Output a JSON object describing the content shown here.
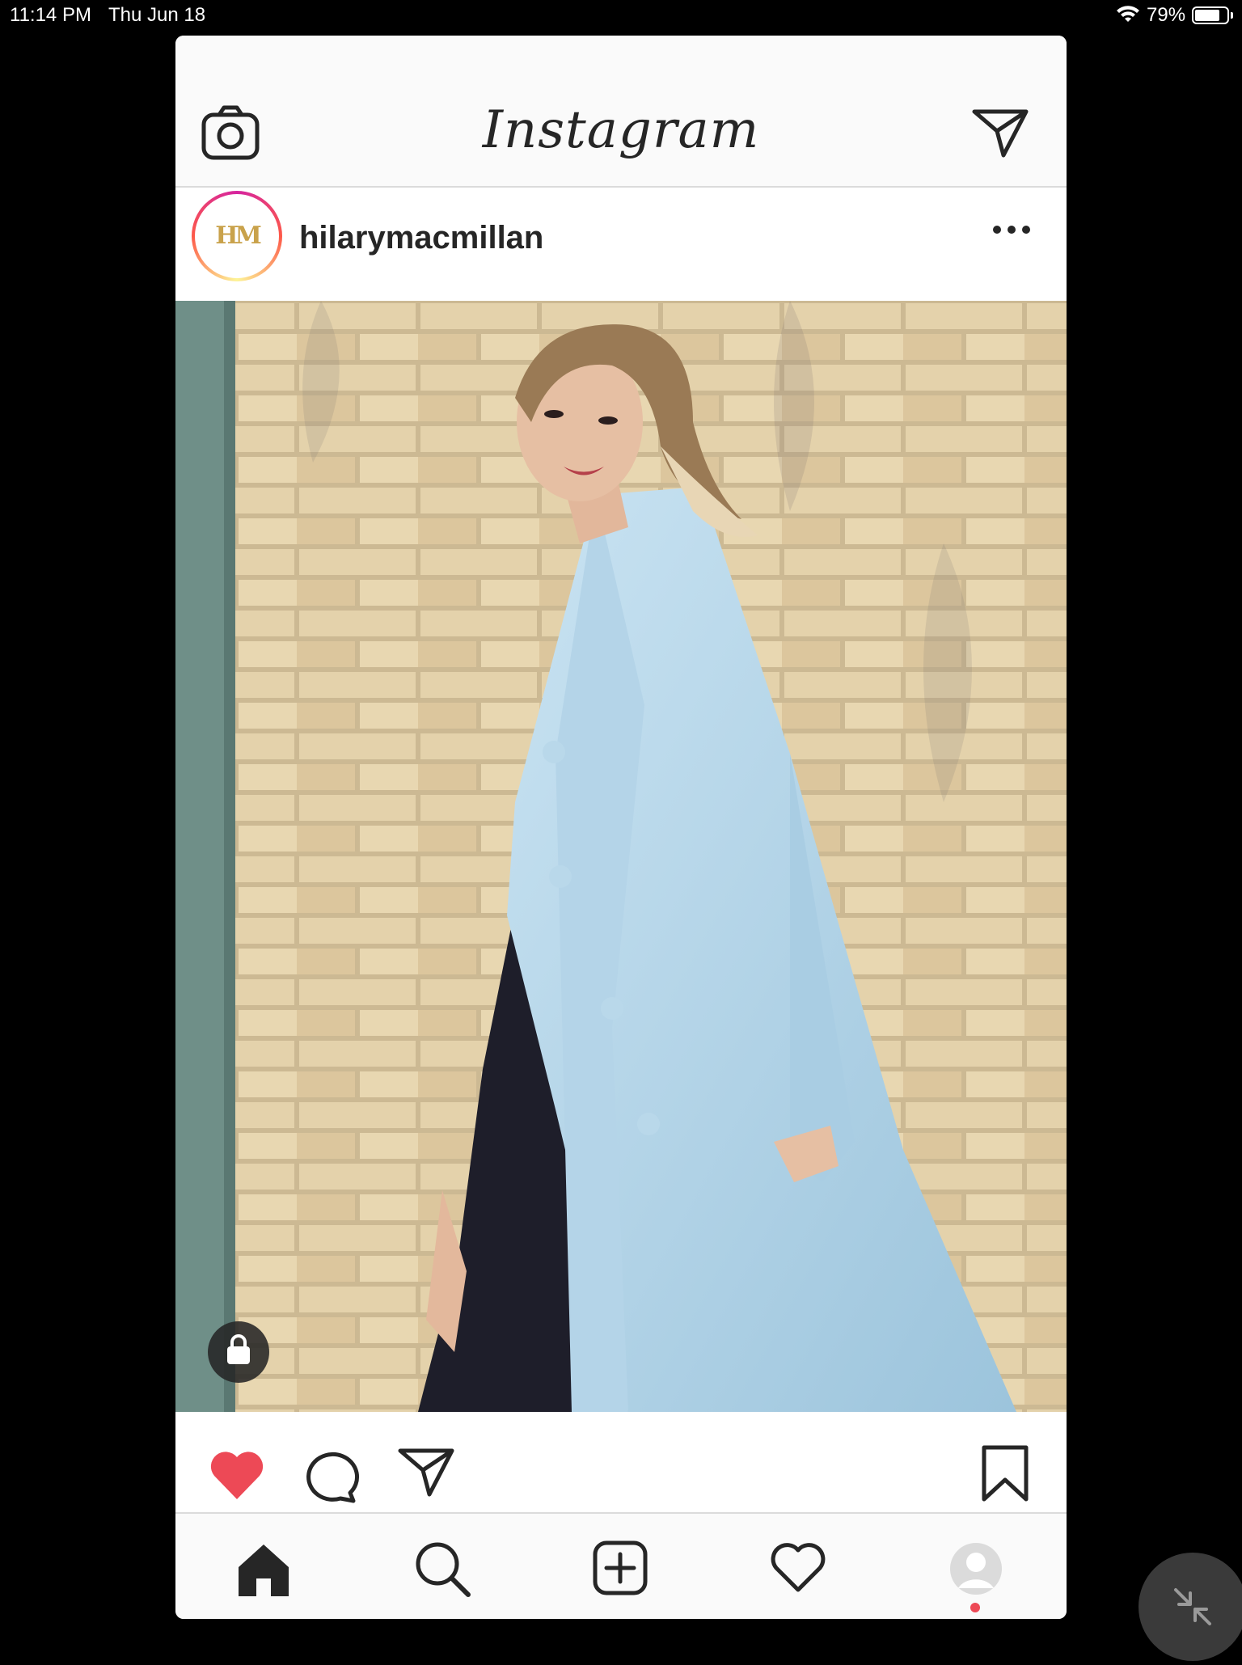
{
  "status_bar": {
    "time": "11:14 PM",
    "date": "Thu Jun 18",
    "battery_percent": "79%",
    "battery_level": 0.79,
    "wifi": "wifi-icon"
  },
  "header": {
    "logo_text": "Instagram",
    "camera_icon": "camera-icon",
    "direct_icon": "paper-plane-icon"
  },
  "post": {
    "username": "hilarymacmillan",
    "avatar_logo_text": "HM",
    "more_icon": "ellipsis-icon",
    "photo_description_icon": "shopping-bag-icon",
    "liked": true
  },
  "actions": {
    "like_icon": "heart-filled-icon",
    "comment_icon": "comment-icon",
    "share_icon": "paper-plane-icon",
    "save_icon": "bookmark-icon"
  },
  "tabbar": {
    "items": [
      "home-icon",
      "search-icon",
      "add-post-icon",
      "activity-heart-icon",
      "profile-avatar-icon"
    ]
  },
  "colors": {
    "like_red": "#ed4956",
    "text": "#262626",
    "border": "#dbdbdb"
  }
}
